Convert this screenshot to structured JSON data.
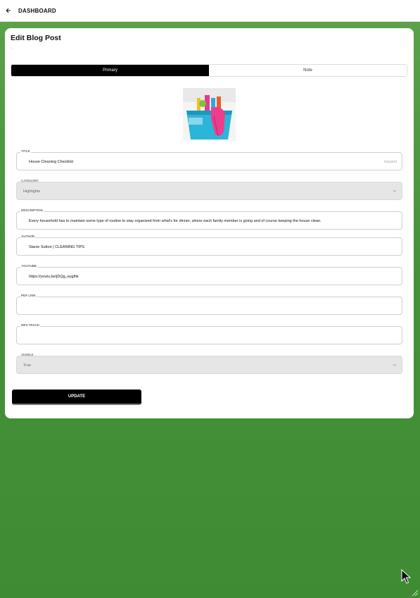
{
  "topbar": {
    "title": "DASHBOARD",
    "back_icon": "arrow-left-icon"
  },
  "page": {
    "title": "Edit Blog Post",
    "subtitle": "-"
  },
  "tabs": [
    {
      "label": "Primary",
      "active": true
    },
    {
      "label": "Note",
      "active": false
    }
  ],
  "image": {
    "alt": "cleaning supplies bucket"
  },
  "fields": {
    "title": {
      "label": "TITLE",
      "value": "House Cleaning Checklist",
      "hint": "required"
    },
    "category": {
      "label": "CATEGORY",
      "value": "Highlights"
    },
    "description": {
      "label": "DESCRIPTION",
      "value": "Every household has to maintain some type of routine to stay organized from what's for dinner, where each family member is going and of course keeping the house clean."
    },
    "author": {
      "label": "AUTHOR",
      "value": "Stacie Sutton | CLEANING TIPS"
    },
    "youtube": {
      "label": "YOUTUBE",
      "value": "https://youtu.be/jDQg_eyglhk"
    },
    "pdf_link": {
      "label": "PDF LINK",
      "value": ""
    },
    "mp3_track": {
      "label": "MP3 TRACK",
      "value": ""
    },
    "visible": {
      "label": "VISIBLE",
      "value": "True"
    }
  },
  "actions": {
    "update_label": "UPDATE"
  },
  "colors": {
    "accent": "#000000",
    "background_green": "#47933b"
  }
}
